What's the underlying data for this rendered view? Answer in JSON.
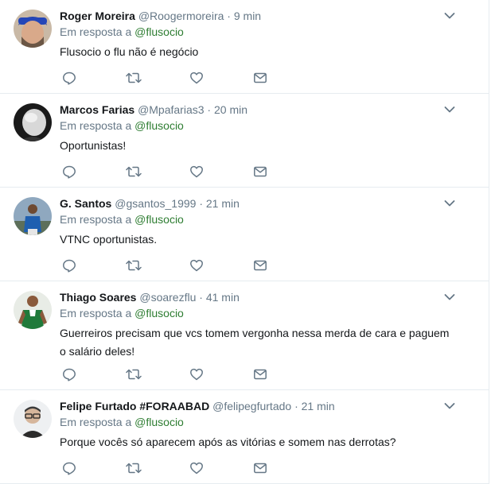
{
  "tweets": [
    {
      "name": "Roger Moreira",
      "handle": "@Roogermoreira",
      "separator": "·",
      "time": "9 min",
      "reply_prefix": "Em resposta a",
      "reply_to": "@flusocio",
      "text": "Flusocio o flu não é negócio"
    },
    {
      "name": "Marcos Farias",
      "handle": "@Mpafarias3",
      "separator": "·",
      "time": "20 min",
      "reply_prefix": "Em resposta a",
      "reply_to": "@flusocio",
      "text": "Oportunistas!"
    },
    {
      "name": "G. Santos",
      "handle": "@gsantos_1999",
      "separator": "·",
      "time": "21 min",
      "reply_prefix": "Em resposta a",
      "reply_to": "@flusocio",
      "text": "VTNC oportunistas."
    },
    {
      "name": "Thiago Soares",
      "handle": "@soarezflu",
      "separator": "·",
      "time": "41 min",
      "reply_prefix": "Em resposta a",
      "reply_to": "@flusocio",
      "text": "Guerreiros precisam que vcs tomem vergonha nessa merda de cara e paguem o salário deles!"
    },
    {
      "name": "Felipe Furtado #FORAABAD",
      "handle": "@felipegfurtado",
      "separator": "·",
      "time": "21 min",
      "reply_prefix": "Em resposta a",
      "reply_to": "@flusocio",
      "text": "Porque vocês só aparecem após as vitórias e somem nas derrotas?"
    }
  ],
  "icons": [
    "reply-icon",
    "retweet-icon",
    "like-icon",
    "direct-message-icon",
    "chevron-down-icon"
  ],
  "colors": {
    "text": "#14171a",
    "secondary": "#657786",
    "mention": "#2e7d32",
    "icon": "#657786",
    "divider": "#e6ecf0"
  }
}
